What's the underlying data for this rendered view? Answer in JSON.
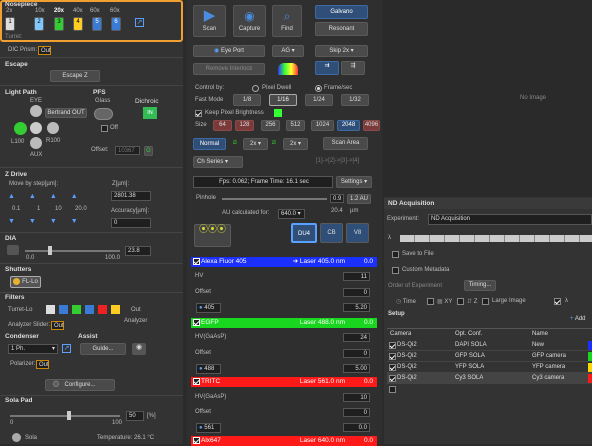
{
  "nosepiece": {
    "title": "Nosepiece",
    "mags": [
      "2x",
      "10x",
      "20x",
      "40x",
      "60x"
    ],
    "mag_extra": "60x",
    "positions": [
      "1",
      "2",
      "3",
      "4",
      "5",
      "6"
    ],
    "selected": "20x",
    "turret_label": "Turret:",
    "turret_value": "2"
  },
  "dic": {
    "label": "DIC Prism:",
    "value": "Out"
  },
  "escape": {
    "title": "Escape",
    "button": "Escape Z"
  },
  "light_path": {
    "title": "Light Path",
    "eye": "EYE",
    "bertrand": "Bertrand OUT",
    "l100": "L100",
    "r100": "R100",
    "aux": "AUX"
  },
  "pfs": {
    "title": "PFS",
    "glass": "Glass",
    "off": "Off",
    "offset_label": "Offset:",
    "offset_value": "10367"
  },
  "dichroic": {
    "title": "Dichroic",
    "value": "IN"
  },
  "zdrive": {
    "title": "Z Drive",
    "move_label": "Move by step[µm]:",
    "z_label": "Z[µm]:",
    "z_value": "2801.38",
    "steps": [
      "0.1",
      "1",
      "10",
      "20.0"
    ],
    "accuracy_label": "Accuracy[µm]:",
    "accuracy_value": "0"
  },
  "dia": {
    "title": "DIA",
    "min": "0.0",
    "max": "100.0",
    "value": "23.8"
  },
  "shutters": {
    "title": "Shutters",
    "fl": "FL-Lo"
  },
  "filters": {
    "title": "Filters",
    "turret_label": "Turret-Lo",
    "out": "Out",
    "analyzer": "Analyzer",
    "analyzer_slider_label": "Analyzer Slider:",
    "analyzer_slider_value": "Out"
  },
  "condenser": {
    "title": "Condenser",
    "value": "1 Ph.",
    "polarizer_label": "Polarizer:",
    "polarizer_value": "Out"
  },
  "assist": {
    "title": "Assist",
    "guide": "Guide..."
  },
  "configure": "Configure...",
  "sola": {
    "title": "Sola Pad",
    "value": "50",
    "unit": "[%]",
    "min": "0",
    "max": "100",
    "label": "Sola",
    "temp": "Temperature: 26.1 °C"
  },
  "toolbar": {
    "scan": "Scan",
    "capture": "Capture",
    "find": "Find",
    "galvano": "Galvano",
    "resonant": "Resonant",
    "eyeport": "Eye Port",
    "ag": "AG",
    "skip": "Skip 2x",
    "remove_interlock": "Remove Interlock"
  },
  "control": {
    "label": "Control by:",
    "pixel": "Pixel Dwell",
    "frame": "Frame/sec",
    "fast_mode": "Fast Mode",
    "ratios": [
      "1/8",
      "1/16",
      "1/24",
      "1/32"
    ],
    "keep": "Keep Pixel Brightness",
    "size_label": "Size",
    "sizes": [
      "64",
      "128",
      "256",
      "512",
      "1024",
      "2048",
      "4096"
    ],
    "normal": "Normal",
    "zoom1": "2x",
    "zoom2": "2x",
    "scan_area": "Scan Area",
    "ch_series": "Ch Series",
    "ch_formula": "[1]->[2]->[3]->[4]"
  },
  "fps": {
    "text": "Fps: 0.062; Frame Time: 16.1 sec",
    "settings": "Settings"
  },
  "pinhole": {
    "label": "Pinhole",
    "value": "0.9",
    "au": "1.2 AU",
    "um": "20.4",
    "unit": "µm",
    "au_calc": "AU calculated for:",
    "au_calc_value": "640.0"
  },
  "detectors": {
    "du4": "DU4",
    "cb": "CB",
    "v8": "V8"
  },
  "channels": [
    {
      "name": "Alexa Fluor 405",
      "laser": "Laser 405.0 nm",
      "val": "0.0",
      "color": "#1b2fff"
    },
    {
      "name": "EGFP",
      "laser": "Laser 488.0 nm",
      "val": "0.0",
      "color": "#19d61f"
    },
    {
      "name": "TRITC",
      "laser": "Laser 561.0 nm",
      "val": "0.0",
      "color": "#ff1a1a"
    },
    {
      "name": "Alx647",
      "laser": "Laser 640.0 nm",
      "val": "0.0",
      "color": "#ff1a1a"
    }
  ],
  "ch1": {
    "hv": "HV",
    "hv_val": "11",
    "offset": "Offset",
    "offset_val": "0",
    "wl": "405",
    "wl_val": "5.20"
  },
  "ch2": {
    "hv": "HV(GaAsP)",
    "hv_val": "24",
    "offset": "Offset",
    "offset_val": "0",
    "wl": "488",
    "wl_val": "5.00"
  },
  "ch3": {
    "hv": "HV(GaAsP)",
    "hv_val": "10",
    "offset": "Offset",
    "offset_val": "0",
    "wl": "561",
    "wl_val": "0.0"
  },
  "noimage": "No Image",
  "nd": {
    "title": "ND Acquisition",
    "experiment_label": "Experiment:",
    "experiment_value": "ND Acquisition",
    "lambda": "λ",
    "save": "Save to File",
    "metadata": "Custom Metadata",
    "order": "Order of Experiment",
    "timing": "Timing...",
    "tabs": [
      "Time",
      "XY",
      "Z",
      "Large Image",
      "λ"
    ],
    "setup": "Setup",
    "add": "Add",
    "columns": [
      "Camera",
      "Opt. Conf.",
      "Name"
    ],
    "rows": [
      {
        "cam": "DS-Qi2",
        "conf": "DAPI SOLA",
        "name": "New",
        "color": "#1b2fff"
      },
      {
        "cam": "DS-Qi2",
        "conf": "GFP SOLA",
        "name": "GFP camera",
        "color": "#19d61f"
      },
      {
        "cam": "DS-Qi2",
        "conf": "YFP SOLA",
        "name": "YFP camera",
        "color": "#ffd700"
      },
      {
        "cam": "DS-Qi2",
        "conf": "Cy3 SOLA",
        "name": "Cy3 camera",
        "color": "#ff1a1a"
      }
    ]
  }
}
